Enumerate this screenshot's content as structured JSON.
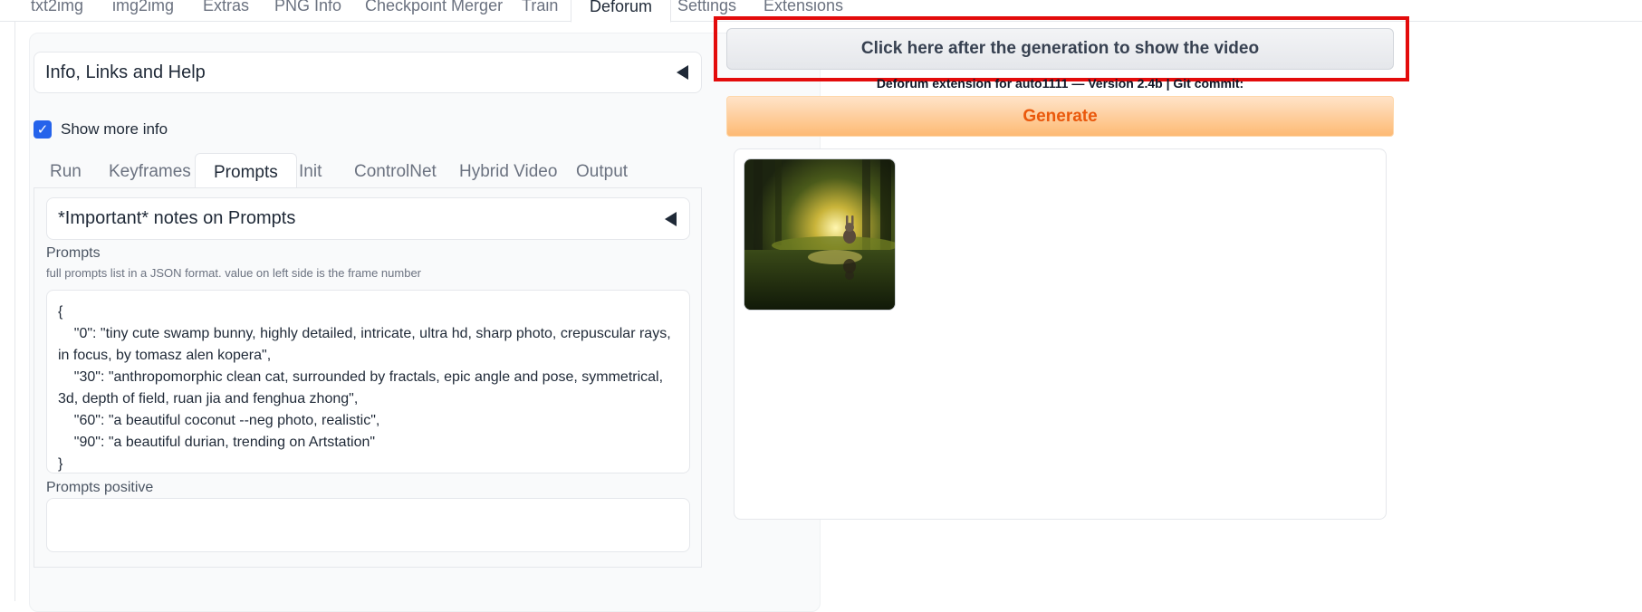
{
  "top_tabs": [
    "txt2img",
    "img2img",
    "Extras",
    "PNG Info",
    "Checkpoint Merger",
    "Train",
    "Deforum",
    "Settings",
    "Extensions"
  ],
  "info_accordion_label": "Info, Links and Help",
  "show_more_info": {
    "label": "Show more info",
    "checked": true
  },
  "sub_tabs": [
    "Run",
    "Keyframes",
    "Prompts",
    "Init",
    "ControlNet",
    "Hybrid Video",
    "Output"
  ],
  "notes_accordion_label": "*Important* notes on Prompts",
  "prompts": {
    "label": "Prompts",
    "info": "full prompts list in a JSON format. value on left side is the frame number",
    "value": "{\n    \"0\": \"tiny cute swamp bunny, highly detailed, intricate, ultra hd, sharp photo, crepuscular rays, in focus, by tomasz alen kopera\",\n    \"30\": \"anthropomorphic clean cat, surrounded by fractals, epic angle and pose, symmetrical, 3d, depth of field, ruan jia and fenghua zhong\",\n    \"60\": \"a beautiful coconut --neg photo, realistic\",\n    \"90\": \"a beautiful durian, trending on Artstation\"\n}"
  },
  "prompts_positive_label": "Prompts positive",
  "video_button_label": "Click here after the generation to show the video",
  "version_text": "Deforum extension for auto1111 — Version 2.4b | Git commit:",
  "generate_label": "Generate",
  "colors": {
    "highlight": "#e30b0b",
    "accent_orange": "#ea580c",
    "checkbox_blue": "#2563eb"
  },
  "gallery": {
    "items": [
      "generated-image"
    ]
  }
}
